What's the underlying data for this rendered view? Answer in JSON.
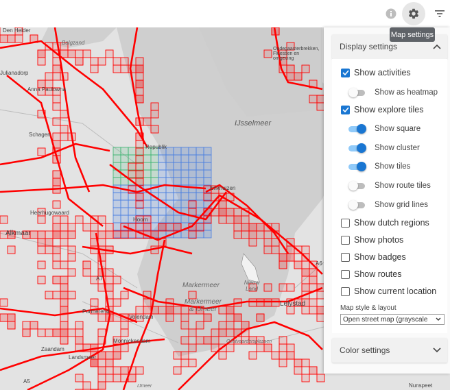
{
  "toolbar": {
    "info_icon": "info-icon",
    "settings_icon": "gear-icon",
    "filter_icon": "filter-icon",
    "tooltip": "Map settings"
  },
  "map": {
    "labels": {
      "den_helder": "Den Helder",
      "balgzand": "Balgzand",
      "julianadorp": "Julianadorp",
      "anna_paulowna": "Anna Paulowna",
      "schagen": "Schagen",
      "heerhugowaard": "Heerhugowaard",
      "alkmaar": "Alkmaar",
      "ijsselmeer": "IJsselmeer",
      "markermeer": "Markermeer",
      "markermeer_ijmeer": "Markermeer & IJmeer",
      "nieuw_land": "Nieuw Land",
      "lelystad": "Lelystad",
      "purmerend": "Purmerend",
      "volendam": "Volendam",
      "monnickendam": "Monnickendam",
      "zaandam": "Zaandam",
      "landsmeer": "Landsmeer",
      "dudegasterbrekken": "Oudegaasterbrekken, Fluessen en omgeving",
      "oostvaardersplassen": "Oostvaardersplassen",
      "enkhuizen": "Enkhuizen",
      "republik": "Republik",
      "hoorn": "Hoorn",
      "a5": "A5",
      "a7": "A7",
      "a6": "A6",
      "nunspeet": "Nunspeet",
      "ijmeer": "IJmeer"
    }
  },
  "panel": {
    "display_settings": {
      "title": "Display settings",
      "show_activities": "Show activities",
      "show_as_heatmap": "Show as heatmap",
      "show_explore_tiles": "Show explore tiles",
      "show_square": "Show square",
      "show_cluster": "Show cluster",
      "show_tiles": "Show tiles",
      "show_route_tiles": "Show route tiles",
      "show_grid_lines": "Show grid lines",
      "show_dutch_regions": "Show dutch regions",
      "show_photos": "Show photos",
      "show_badges": "Show badges",
      "show_routes": "Show routes",
      "show_current_location": "Show current location",
      "map_style_label": "Map style & layout",
      "map_style_value": "Open street map (grayscale"
    },
    "color_settings": {
      "title": "Color settings"
    }
  },
  "colors": {
    "accent": "#1976d2",
    "track": "#ff0000",
    "square": "#4a7fe0",
    "cluster": "#3cb371"
  }
}
